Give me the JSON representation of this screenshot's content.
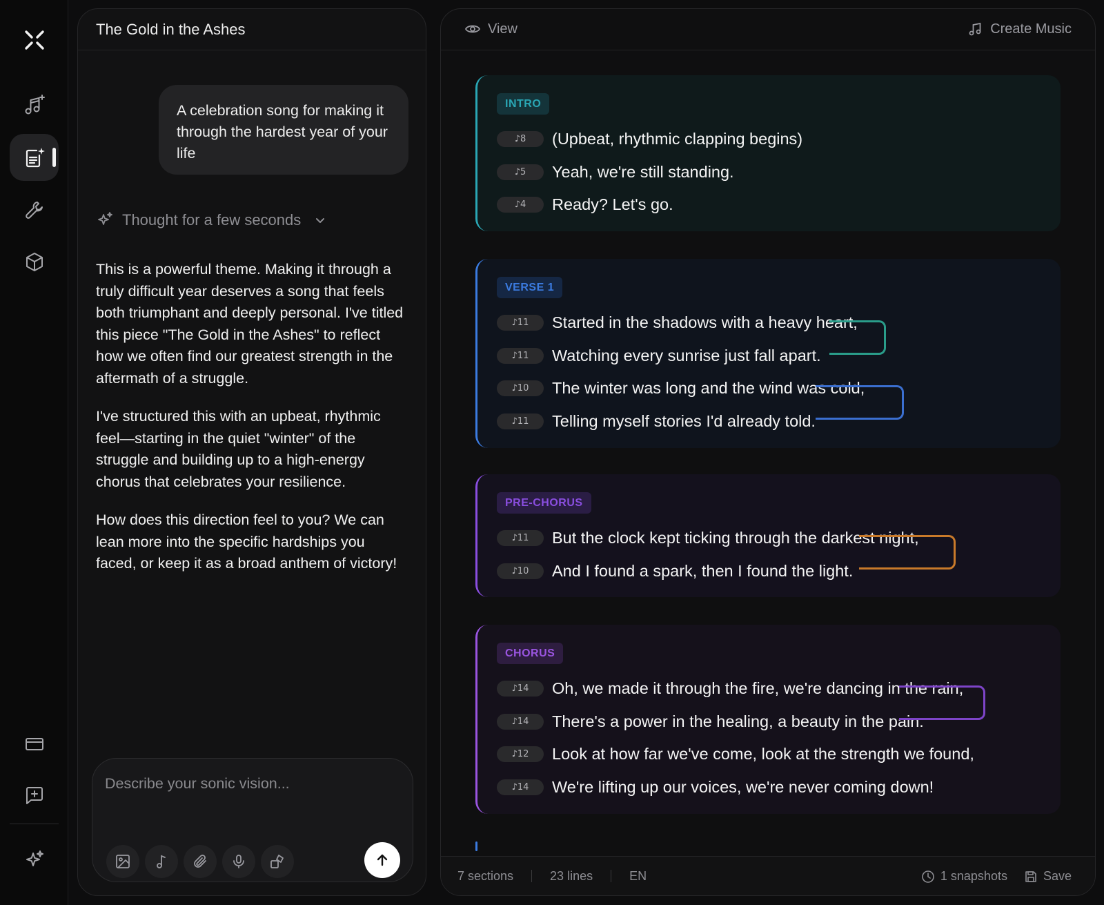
{
  "chat": {
    "title": "The Gold in the Ashes",
    "user_message": "A celebration song for making it through the hardest year of your life",
    "thought_label": "Thought for a few seconds",
    "reply": [
      "This is a powerful theme. Making it through a truly difficult year deserves a song that feels both triumphant and deeply personal. I've titled this piece \"The Gold in the Ashes\" to reflect how we often find our greatest strength in the aftermath of a struggle.",
      "I've structured this with an upbeat, rhythmic feel—starting in the quiet \"winter\" of the struggle and building up to a high-energy chorus that celebrates your resilience.",
      "How does this direction feel to you? We can lean more into the specific hardships you faced, or keep it as a broad anthem of victory!"
    ],
    "composer_placeholder": "Describe your sonic vision..."
  },
  "editor": {
    "view_label": "View",
    "create_label": "Create Music",
    "sections": [
      {
        "tag": "INTRO",
        "accent": "#2aa7b5",
        "bg": "#0f1a1b",
        "tag_bg": "#14343a",
        "lines": [
          {
            "syllables": "♪8",
            "text": "(Upbeat, rhythmic clapping begins)"
          },
          {
            "syllables": "♪5",
            "text": "Yeah, we're still standing."
          },
          {
            "syllables": "♪4",
            "text": "Ready? Let's go."
          }
        ]
      },
      {
        "tag": "VERSE 1",
        "accent": "#3b7be0",
        "bg": "#0f141d",
        "tag_bg": "#152744",
        "lines": [
          {
            "syllables": "♪11",
            "text": "Started in the shadows with a heavy heart,"
          },
          {
            "syllables": "♪11",
            "text": "Watching every sunrise just fall apart."
          },
          {
            "syllables": "♪10",
            "text": "The winter was long and the wind was cold,"
          },
          {
            "syllables": "♪11",
            "text": "Telling myself stories I'd already told."
          }
        ]
      },
      {
        "tag": "PRE-CHORUS",
        "accent": "#8a4ee0",
        "bg": "#14111d",
        "tag_bg": "#2a1d44",
        "lines": [
          {
            "syllables": "♪11",
            "text": "But the clock kept ticking through the darkest night,"
          },
          {
            "syllables": "♪10",
            "text": "And I found a spark, then I found the light."
          }
        ]
      },
      {
        "tag": "CHORUS",
        "accent": "#9a55e0",
        "bg": "#15111b",
        "tag_bg": "#2e1d40",
        "lines": [
          {
            "syllables": "♪14",
            "text": "Oh, we made it through the fire, we're dancing in the rain,"
          },
          {
            "syllables": "♪14",
            "text": "There's a power in the healing, a beauty in the pain."
          },
          {
            "syllables": "♪12",
            "text": "Look at how far we've come, look at the strength we found,"
          },
          {
            "syllables": "♪14",
            "text": "We're lifting up our voices, we're never coming down!"
          }
        ]
      }
    ],
    "footer": {
      "sections": "7 sections",
      "lines": "23 lines",
      "lang": "EN",
      "snapshots": "1 snapshots",
      "save": "Save"
    }
  },
  "colors": {
    "rhyme_teal": "#2a9d8a",
    "rhyme_blue": "#3b6fd0",
    "rhyme_orange": "#c97a2a",
    "rhyme_purple": "#7d44c8"
  }
}
